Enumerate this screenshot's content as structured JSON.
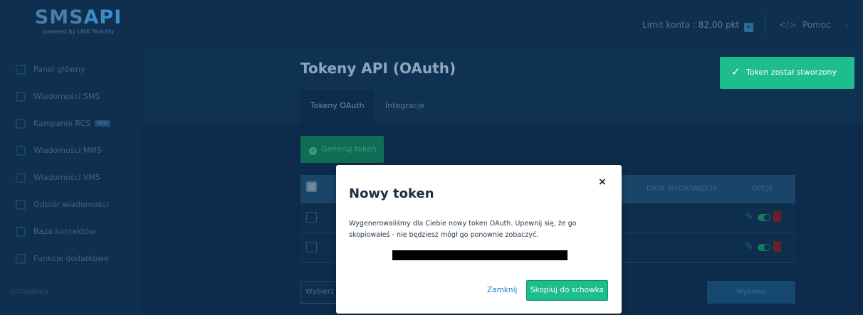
{
  "header": {
    "logo_text": "SMSAPI",
    "logo_subtext": "powered by LINK Mobility",
    "limit_label": "Limit konta :",
    "limit_value": "82,00 pkt",
    "help_label": "Pomoc"
  },
  "sidebar": {
    "items": [
      {
        "label": "Panel główny",
        "icon": "home-icon",
        "chevron": false
      },
      {
        "label": "Wiadomości SMS",
        "icon": "sms-icon",
        "chevron": true
      },
      {
        "label": "Kampanie RCS",
        "icon": "rcs-icon",
        "chevron": true,
        "badge": "NEW"
      },
      {
        "label": "Wiadomości MMS",
        "icon": "mms-icon",
        "chevron": true
      },
      {
        "label": "Wiadomości VMS",
        "icon": "vms-icon",
        "chevron": true
      },
      {
        "label": "Odbiór wiadomości",
        "icon": "inbox-icon",
        "chevron": true
      },
      {
        "label": "Baza kontaktów",
        "icon": "contacts-icon",
        "chevron": true
      },
      {
        "label": "Funkcje dodatkowe",
        "icon": "extras-icon",
        "chevron": true
      }
    ],
    "section_label": "USTAWIENIA"
  },
  "main": {
    "title": "Tokeny API (OAuth)",
    "tabs": [
      {
        "label": "Tokeny OAuth",
        "active": true
      },
      {
        "label": "Integracje",
        "active": false
      }
    ],
    "generate_button": "Generuj token",
    "table": {
      "headers": {
        "expiry": "DATA WYGAŚNIĘCIA",
        "options": "OPCJE"
      },
      "rows": [
        {
          "expiry": "-"
        },
        {
          "expiry": "-"
        }
      ]
    },
    "select_label": "Wybierz",
    "execute_button": "Wykonaj"
  },
  "toast": {
    "message": "Token został stworzony",
    "color": "#1dbd8c"
  },
  "modal": {
    "title": "Nowy token",
    "body": "Wygenerowaliśmy dla Ciebie nowy token OAuth. Upewnij się, że go skopiowałeś - nie będziesz mógł go ponownie zobaczyć.",
    "close_link": "Zamknij",
    "copy_button": "Skopiuj do schowka",
    "close_symbol": "×"
  },
  "colors": {
    "navy": "#0f2f4f",
    "accent_green": "#1dbd8c",
    "link_blue": "#1a7fbf"
  }
}
